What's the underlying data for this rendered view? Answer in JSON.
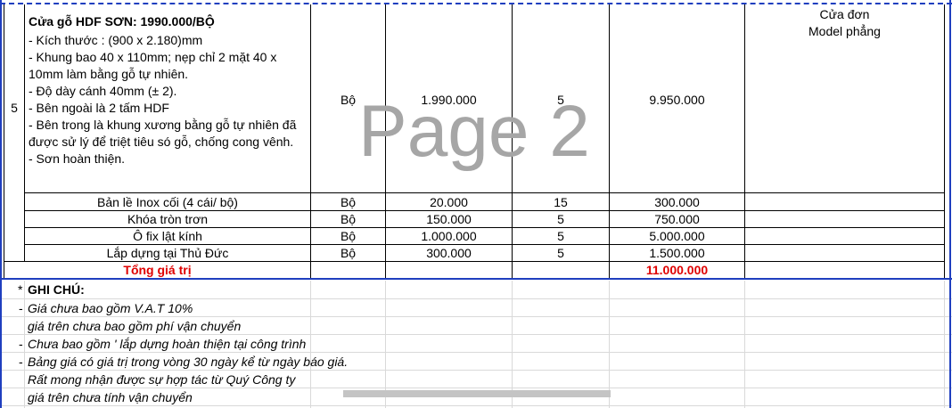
{
  "product": {
    "row_no": "5",
    "title": "Cửa gỗ HDF SƠN: 1990.000/BỘ",
    "details": [
      "- Kích thước : (900 x 2.180)mm",
      "- Khung bao 40 x 110mm; nẹp chỉ 2 mặt 40 x",
      "10mm làm bằng gỗ tự nhiên.",
      "- Độ dày cánh 40mm (± 2).",
      "- Bên ngoài là 2 tấm HDF",
      "- Bên trong là khung xương bằng gỗ tự nhiên đã",
      "được sử lý để triệt tiêu só gỗ, chống cong vênh.",
      "- Sơn hoàn thiện."
    ],
    "unit": "Bộ",
    "price": "1.990.000",
    "qty": "5",
    "amount": "9.950.000",
    "note_line1": "Cửa đơn",
    "note_line2": "Model phẳng"
  },
  "items": [
    {
      "name": "Bản lề Inox cối (4 cái/ bộ)",
      "unit": "Bộ",
      "price": "20.000",
      "qty": "15",
      "amount": "300.000"
    },
    {
      "name": "Khóa tròn trơn",
      "unit": "Bộ",
      "price": "150.000",
      "qty": "5",
      "amount": "750.000"
    },
    {
      "name": "Ô fix lật kính",
      "unit": "Bộ",
      "price": "1.000.000",
      "qty": "5",
      "amount": "5.000.000"
    },
    {
      "name": "Lắp dựng tại Thủ Đức",
      "unit": "Bộ",
      "price": "300.000",
      "qty": "5",
      "amount": "1.500.000"
    }
  ],
  "total": {
    "label": "Tổng giá trị",
    "amount": "11.000.000"
  },
  "notes": {
    "star": "*",
    "heading": "GHI CHÚ:",
    "lines": [
      {
        "bullet": "-",
        "text": "Giá chưa bao gồm V.A.T 10%"
      },
      {
        "bullet": "",
        "text": "giá trên chưa bao gồm phí vận chuyển"
      },
      {
        "bullet": "-",
        "text": "Chưa bao gồm ' lắp dựng hoàn thiện tại công trình"
      },
      {
        "bullet": "-",
        "text": "Bảng giá có giá trị trong vòng 30 ngày kể từ ngày báo giá."
      },
      {
        "bullet": "",
        "text": "Rất mong nhận được sự hợp tác từ Quý Công ty"
      },
      {
        "bullet": "",
        "text": "giá trên chưa tính vận chuyển"
      }
    ]
  },
  "watermark": "Page 2",
  "colors": {
    "page_break": "#1f3fbf",
    "total_text": "#e00000",
    "watermark": "#a6a6a6",
    "gridline": "#d9d9d9"
  }
}
